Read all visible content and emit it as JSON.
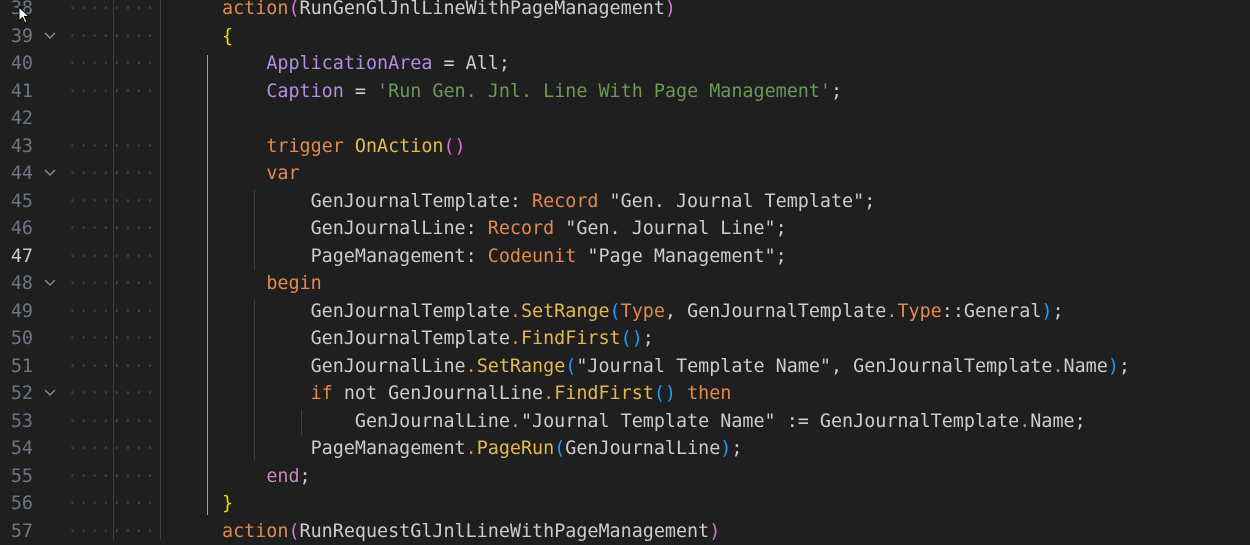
{
  "editor": {
    "lines": [
      {
        "n": "38",
        "fold": false,
        "active": false,
        "tokens": [
          [
            "dots",
            "········"
          ],
          [
            "pl",
            "      "
          ],
          [
            "kw",
            "action"
          ],
          [
            "paren-pink",
            "("
          ],
          [
            "pl",
            "RunGenGlJnlLineWithPageManagement"
          ],
          [
            "paren-pink",
            ")"
          ]
        ]
      },
      {
        "n": "39",
        "fold": true,
        "active": false,
        "tokens": [
          [
            "dots",
            "········"
          ],
          [
            "pl",
            "      "
          ],
          [
            "brace-gold",
            "{"
          ]
        ]
      },
      {
        "n": "40",
        "fold": false,
        "active": false,
        "tokens": [
          [
            "dots",
            "········"
          ],
          [
            "pl",
            "          "
          ],
          [
            "prop2",
            "ApplicationArea"
          ],
          [
            "pl",
            " = All;"
          ]
        ]
      },
      {
        "n": "41",
        "fold": false,
        "active": false,
        "tokens": [
          [
            "dots",
            "········"
          ],
          [
            "pl",
            "          "
          ],
          [
            "prop2",
            "Caption"
          ],
          [
            "pl",
            " = "
          ],
          [
            "str",
            "'Run Gen. Jnl. Line With Page Management'"
          ],
          [
            "pl",
            ";"
          ]
        ]
      },
      {
        "n": "42",
        "fold": false,
        "active": false,
        "tokens": []
      },
      {
        "n": "43",
        "fold": false,
        "active": false,
        "tokens": [
          [
            "dots",
            "········"
          ],
          [
            "pl",
            "          "
          ],
          [
            "kw",
            "trigger "
          ],
          [
            "fn",
            "OnAction"
          ],
          [
            "paren-pink",
            "()"
          ]
        ]
      },
      {
        "n": "44",
        "fold": true,
        "active": false,
        "tokens": [
          [
            "dots",
            "········"
          ],
          [
            "pl",
            "          "
          ],
          [
            "kw",
            "var"
          ]
        ]
      },
      {
        "n": "45",
        "fold": false,
        "active": false,
        "tokens": [
          [
            "dots",
            "········"
          ],
          [
            "pl",
            "              GenJournalTemplate: "
          ],
          [
            "kw",
            "Record"
          ],
          [
            "pl",
            " \"Gen. Journal Template\";"
          ]
        ]
      },
      {
        "n": "46",
        "fold": false,
        "active": false,
        "tokens": [
          [
            "dots",
            "········"
          ],
          [
            "pl",
            "              GenJournalLine: "
          ],
          [
            "kw",
            "Record"
          ],
          [
            "pl",
            " \"Gen. Journal Line\";"
          ]
        ]
      },
      {
        "n": "47",
        "fold": false,
        "active": true,
        "tokens": [
          [
            "dots",
            "········"
          ],
          [
            "pl",
            "              PageManagement: "
          ],
          [
            "kw",
            "Codeunit"
          ],
          [
            "pl",
            " \"Page Management\";"
          ]
        ]
      },
      {
        "n": "48",
        "fold": true,
        "active": false,
        "tokens": [
          [
            "dots",
            "········"
          ],
          [
            "pl",
            "          "
          ],
          [
            "kw",
            "begin"
          ]
        ]
      },
      {
        "n": "49",
        "fold": false,
        "active": false,
        "tokens": [
          [
            "dots",
            "········"
          ],
          [
            "pl",
            "              GenJournalTemplate"
          ],
          [
            "kw",
            "."
          ],
          [
            "fn",
            "SetRange"
          ],
          [
            "paren-blue",
            "("
          ],
          [
            "kw",
            "Type"
          ],
          [
            "pl",
            ", GenJournalTemplate"
          ],
          [
            "kw",
            "."
          ],
          [
            "kw",
            "Type"
          ],
          [
            "pl",
            "::General"
          ],
          [
            "paren-blue",
            ")"
          ],
          [
            "pl",
            ";"
          ]
        ]
      },
      {
        "n": "50",
        "fold": false,
        "active": false,
        "tokens": [
          [
            "dots",
            "········"
          ],
          [
            "pl",
            "              GenJournalTemplate"
          ],
          [
            "kw",
            "."
          ],
          [
            "fn",
            "FindFirst"
          ],
          [
            "paren-blue",
            "()"
          ],
          [
            "pl",
            ";"
          ]
        ]
      },
      {
        "n": "51",
        "fold": false,
        "active": false,
        "tokens": [
          [
            "dots",
            "········"
          ],
          [
            "pl",
            "              GenJournalLine"
          ],
          [
            "kw",
            "."
          ],
          [
            "fn",
            "SetRange"
          ],
          [
            "paren-blue",
            "("
          ],
          [
            "pl",
            "\"Journal Template Name\", GenJournalTemplate"
          ],
          [
            "kw",
            "."
          ],
          [
            "pl",
            "Name"
          ],
          [
            "paren-blue",
            ")"
          ],
          [
            "pl",
            ";"
          ]
        ]
      },
      {
        "n": "52",
        "fold": true,
        "active": false,
        "tokens": [
          [
            "dots",
            "········"
          ],
          [
            "pl",
            "              "
          ],
          [
            "kw",
            "if"
          ],
          [
            "pl",
            " not GenJournalLine"
          ],
          [
            "kw",
            "."
          ],
          [
            "fn",
            "FindFirst"
          ],
          [
            "paren-blue",
            "()"
          ],
          [
            "pl",
            " "
          ],
          [
            "kw",
            "then"
          ]
        ]
      },
      {
        "n": "53",
        "fold": false,
        "active": false,
        "tokens": [
          [
            "dots",
            "········"
          ],
          [
            "pl",
            "                  GenJournalLine"
          ],
          [
            "kw",
            "."
          ],
          [
            "pl",
            "\"Journal Template Name\" := GenJournalTemplate"
          ],
          [
            "kw",
            "."
          ],
          [
            "pl",
            "Name;"
          ]
        ]
      },
      {
        "n": "54",
        "fold": false,
        "active": false,
        "tokens": [
          [
            "dots",
            "········"
          ],
          [
            "pl",
            "              PageManagement"
          ],
          [
            "kw",
            "."
          ],
          [
            "fn",
            "PageRun"
          ],
          [
            "paren-blue",
            "("
          ],
          [
            "pl",
            "GenJournalLine"
          ],
          [
            "paren-blue",
            ")"
          ],
          [
            "pl",
            ";"
          ]
        ]
      },
      {
        "n": "55",
        "fold": false,
        "active": false,
        "tokens": [
          [
            "dots",
            "········"
          ],
          [
            "pl",
            "          "
          ],
          [
            "prop",
            "end"
          ],
          [
            "pl",
            ";"
          ]
        ]
      },
      {
        "n": "56",
        "fold": false,
        "active": false,
        "tokens": [
          [
            "dots",
            "········"
          ],
          [
            "pl",
            "      "
          ],
          [
            "brace-gold",
            "}"
          ]
        ]
      },
      {
        "n": "57",
        "fold": false,
        "active": false,
        "tokens": [
          [
            "dots",
            "········"
          ],
          [
            "pl",
            "      "
          ],
          [
            "kw",
            "action"
          ],
          [
            "paren-pink",
            "("
          ],
          [
            "pl",
            "RunRequestGlJnlLineWithPageManagement"
          ],
          [
            "paren-pink",
            ")"
          ]
        ]
      }
    ]
  },
  "icons": {
    "fold": "chevron-down-icon",
    "cursor": "mouse-pointer-icon"
  }
}
